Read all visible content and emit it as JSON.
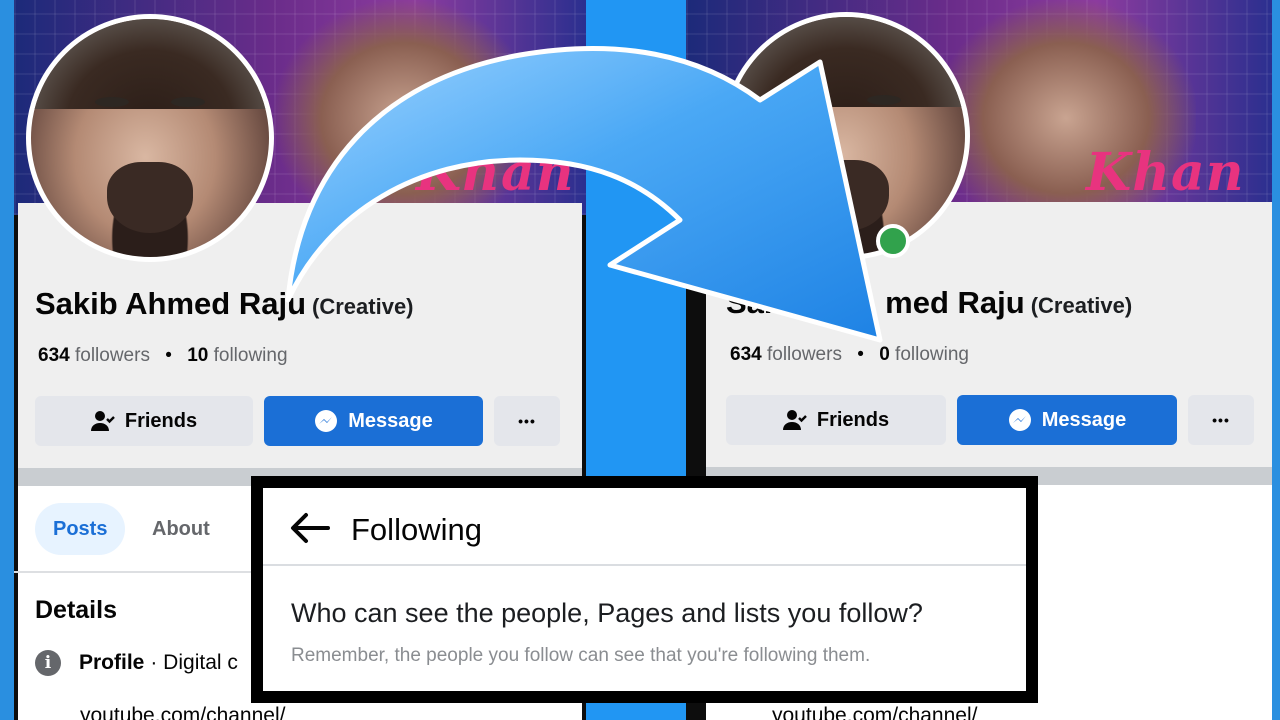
{
  "left_profile": {
    "name": "Sakib Ahmed Raju",
    "category": "(Creative)",
    "followers_count": "634",
    "followers_label": "followers",
    "separator": "•",
    "following_count": "10",
    "following_label": "following",
    "friends_label": "Friends",
    "message_label": "Message",
    "more_label": "•••",
    "cover_text": "Khan",
    "tabs": [
      {
        "label": "Posts"
      },
      {
        "label": "About"
      }
    ],
    "details_title": "Details",
    "info_glyph": "i",
    "details_profile_label": "Profile",
    "details_profile_value": "· Digital c",
    "url_text": "youtube.com/channel/"
  },
  "right_profile": {
    "name_visible_start": "Sak",
    "name_visible_end": "med Raju",
    "category": "(Creative)",
    "followers_count": "634",
    "followers_label": "followers",
    "separator": "•",
    "following_count": "0",
    "following_label": "following",
    "friends_label": "Friends",
    "message_label": "Message",
    "more_label": "•••",
    "cover_text": "Khan",
    "url_text": "youtube.com/channel/"
  },
  "dialog": {
    "back_icon": "arrow-left-icon",
    "title": "Following",
    "question": "Who can see the people, Pages and lists you follow?",
    "note": "Remember, the people you follow can see that you're following them."
  },
  "colors": {
    "background_blue": "#2196f3",
    "messenger_blue": "#1b6fd6",
    "online_green": "#31a24c",
    "cover_script_pink": "#e8337f"
  }
}
